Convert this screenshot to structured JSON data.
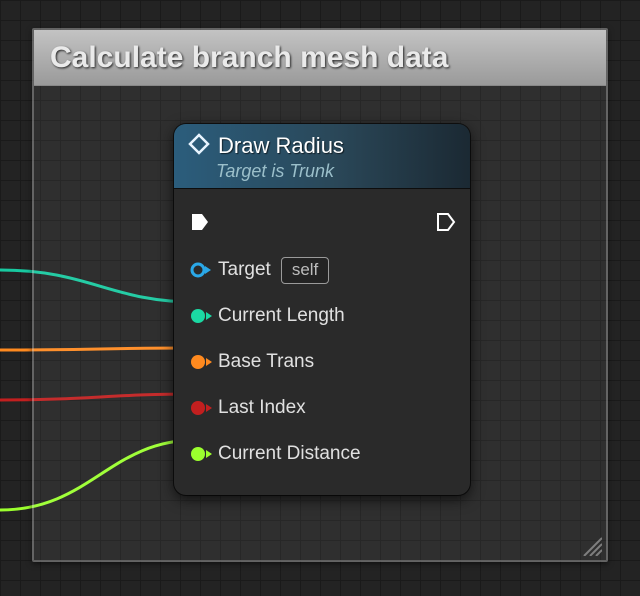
{
  "comment": {
    "title": "Calculate branch mesh data"
  },
  "node": {
    "title": "Draw Radius",
    "subtitle": "Target is Trunk",
    "target_label": "Target",
    "target_default": "self",
    "pins": {
      "current_length": {
        "label": "Current Length",
        "color": "#1bd9a3"
      },
      "base_trans": {
        "label": "Base Trans",
        "color": "#ff8a1f"
      },
      "last_index": {
        "label": "Last Index",
        "color": "#c21f1f"
      },
      "current_distance": {
        "label": "Current Distance",
        "color": "#9bff2e"
      }
    },
    "wires": {
      "current_length": "#18c9a0",
      "base_trans": "#ff8a1f",
      "last_index": "#c21f1f",
      "current_distance": "#9bff2e"
    }
  }
}
